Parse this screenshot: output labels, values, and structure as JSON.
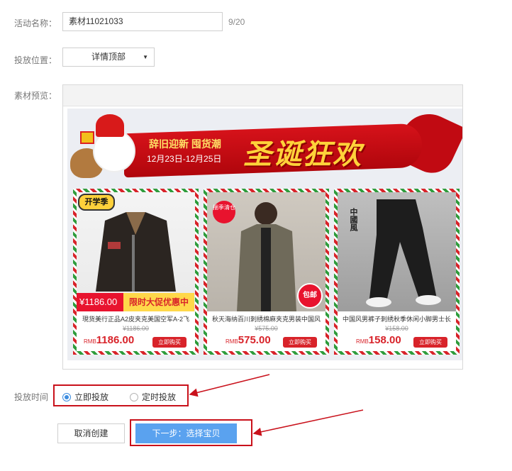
{
  "form": {
    "name_label": "活动名称：",
    "name_value": "素材11021033",
    "name_counter": "9/20",
    "position_label": "投放位置：",
    "position_value": "详情顶部",
    "preview_label": "素材预览：",
    "schedule_label": "投放时间",
    "schedule_options": [
      {
        "label": "立即投放",
        "checked": true
      },
      {
        "label": "定时投放",
        "checked": false
      }
    ],
    "cancel_label": "取消创建",
    "next_label": "下一步：选择宝贝"
  },
  "banner": {
    "headline": "辞旧迎新 囤货潮",
    "dates": "12月23日-12月25日",
    "big_title": "圣诞狂欢"
  },
  "products": [
    {
      "badge": "开学季",
      "tag_price": "¥1186.00",
      "tag_promo": "限时大促优惠中",
      "title": "現货美行正品A2皮夹克美国空军A-2飞",
      "original_price": "¥1186.00",
      "currency": "RMB",
      "price": "1186.00",
      "buy_label": "立即购买"
    },
    {
      "badge": "揣季清仓",
      "badge2": "包邮",
      "title": "秋天海纳百川刺绣棉麻夹克男装中国风",
      "original_price": "¥575.00",
      "currency": "RMB",
      "price": "575.00",
      "buy_label": "立即购买"
    },
    {
      "badge": "中國風",
      "title": "中国风男裤子刺绣秋季休闲小脚男士长",
      "original_price": "¥158.00",
      "currency": "RMB",
      "price": "158.00",
      "buy_label": "立即购买"
    }
  ],
  "colors": {
    "accent_blue": "#5aa2ef",
    "annotation_red": "#c9111b",
    "price_red": "#d8232a"
  }
}
